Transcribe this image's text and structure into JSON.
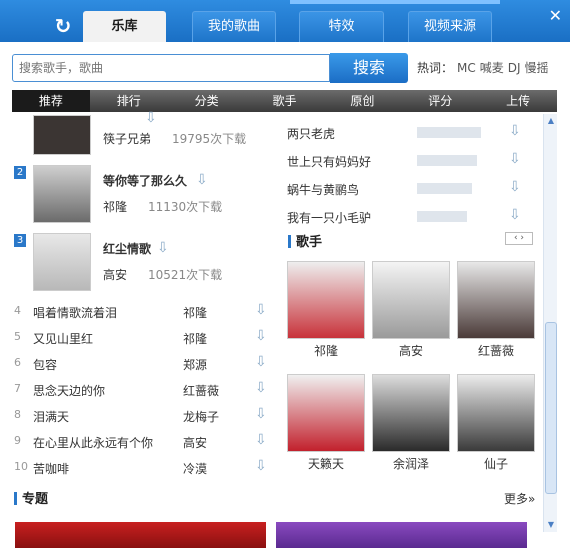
{
  "tabs": [
    "乐库",
    "我的歌曲",
    "特效",
    "视频来源"
  ],
  "search": {
    "placeholder": "搜索歌手，歌曲",
    "button": "搜索"
  },
  "hot": {
    "label": "热词：",
    "items": [
      "MC",
      "喊麦",
      "DJ",
      "慢摇"
    ]
  },
  "nav": [
    "推荐",
    "排行",
    "分类",
    "歌手",
    "原创",
    "评分",
    "上传"
  ],
  "top": [
    {
      "rank": "",
      "title": "",
      "artist": "筷子兄弟",
      "count": "19795次下载"
    },
    {
      "rank": "2",
      "title": "等你等了那么久",
      "artist": "祁隆",
      "count": "11130次下载"
    },
    {
      "rank": "3",
      "title": "红尘情歌",
      "artist": "高安",
      "count": "10521次下载"
    }
  ],
  "list": [
    {
      "n": "4",
      "t": "唱着情歌流着泪",
      "a": "祁隆"
    },
    {
      "n": "5",
      "t": "又见山里红",
      "a": "祁隆"
    },
    {
      "n": "6",
      "t": "包容",
      "a": "郑源"
    },
    {
      "n": "7",
      "t": "思念天边的你",
      "a": "红蔷薇"
    },
    {
      "n": "8",
      "t": "泪满天",
      "a": "龙梅子"
    },
    {
      "n": "9",
      "t": "在心里从此永远有个你",
      "a": "高安"
    },
    {
      "n": "10",
      "t": "苦咖啡",
      "a": "冷漠"
    }
  ],
  "right_songs": [
    "两只老虎",
    "世上只有妈妈好",
    "蜗牛与黄鹂鸟",
    "我有一只小毛驴"
  ],
  "singers_title": "歌手",
  "singers": [
    "祁隆",
    "高安",
    "红蔷薇",
    "天籁天",
    "余润泽",
    "仙子"
  ],
  "topic_title": "专题",
  "more": "更多»"
}
